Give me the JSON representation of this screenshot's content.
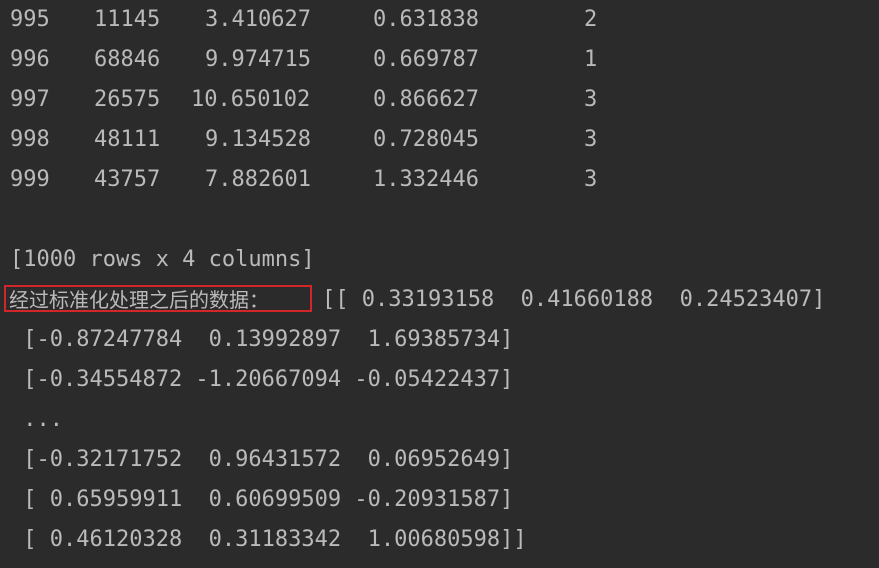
{
  "dataframe_tail": [
    [
      "995",
      "11145",
      "3.410627",
      "0.631838",
      "2"
    ],
    [
      "996",
      "68846",
      "9.974715",
      "0.669787",
      "1"
    ],
    [
      "997",
      "26575",
      "10.650102",
      "0.866627",
      "3"
    ],
    [
      "998",
      "48111",
      "9.134528",
      "0.728045",
      "3"
    ],
    [
      "999",
      "43757",
      "7.882601",
      "1.332446",
      "3"
    ]
  ],
  "shape_line": "[1000 rows x 4 columns]",
  "normalized_label": "经过标准化处理之后的数据：",
  "array_lines": [
    "[[ 0.33193158  0.41660188  0.24523407]",
    " [-0.87247784  0.13992897  1.69385734]",
    " [-0.34554872 -1.20667094 -0.05422437]",
    " ...",
    " [-0.32171752  0.96431572  0.06952649]",
    " [ 0.65959911  0.60699509 -0.20931587]",
    " [ 0.46120328  0.31183342  1.00680598]]"
  ],
  "colors": {
    "background": "#2b2b2b",
    "text": "#bababa",
    "highlight_border": "#d3262b"
  }
}
